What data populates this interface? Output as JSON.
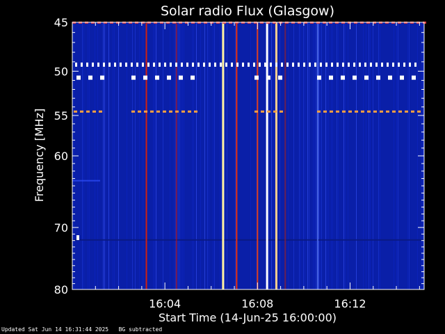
{
  "chart_data": {
    "type": "heatmap",
    "title": "Solar radio Flux (Glasgow)",
    "xlabel": "Start Time (14-Jun-25 16:00:00)",
    "ylabel": "Frequency [MHz]",
    "x_unit": "minutes after 16:00:00",
    "xlim": [
      0,
      15.2
    ],
    "ylim": [
      45,
      80
    ],
    "y_scale": "log",
    "x_ticks": [
      {
        "value": 4,
        "label": "16:04"
      },
      {
        "value": 8,
        "label": "16:08"
      },
      {
        "value": 12,
        "label": "16:12"
      }
    ],
    "y_ticks": [
      {
        "value": 45,
        "label": "45"
      },
      {
        "value": 50,
        "label": "50"
      },
      {
        "value": 55,
        "label": "55"
      },
      {
        "value": 60,
        "label": "60"
      },
      {
        "value": 70,
        "label": "70"
      },
      {
        "value": 80,
        "label": "80"
      }
    ],
    "colormap": {
      "low": "#0a1fa8",
      "mid": "#c81010",
      "high": "#ffffff"
    },
    "vertical_bursts": [
      {
        "t": 3.2,
        "intensity": "medium",
        "color": "#d02010"
      },
      {
        "t": 4.5,
        "intensity": "low",
        "color": "#a01020"
      },
      {
        "t": 6.5,
        "intensity": "high",
        "color": "#fff2a0"
      },
      {
        "t": 7.1,
        "intensity": "medium",
        "color": "#e83010"
      },
      {
        "t": 8.0,
        "intensity": "medium",
        "color": "#e04020"
      },
      {
        "t": 8.4,
        "intensity": "high",
        "color": "#ffffff"
      },
      {
        "t": 8.8,
        "intensity": "high",
        "color": "#ffd090"
      },
      {
        "t": 9.2,
        "intensity": "low",
        "color": "#902030"
      },
      {
        "t": 10.6,
        "intensity": "low",
        "color": "#6080ff"
      }
    ],
    "interference_lines": [
      {
        "freq": 45.0,
        "color": "#e04040",
        "pattern": "dashed"
      },
      {
        "freq": 49.3,
        "color": "#ffffff",
        "pattern": "dotted"
      },
      {
        "freq": 50.7,
        "color": "#ffffff",
        "pattern": "blocks"
      },
      {
        "freq": 54.5,
        "color": "#ffa040",
        "pattern": "dashed"
      },
      {
        "freq": 71.5,
        "color": "#ffffff",
        "pattern": "single"
      }
    ]
  },
  "footer": {
    "updated": "Updated Sat Jun 14 16:31:44 2025",
    "note": "BG subtracted"
  }
}
